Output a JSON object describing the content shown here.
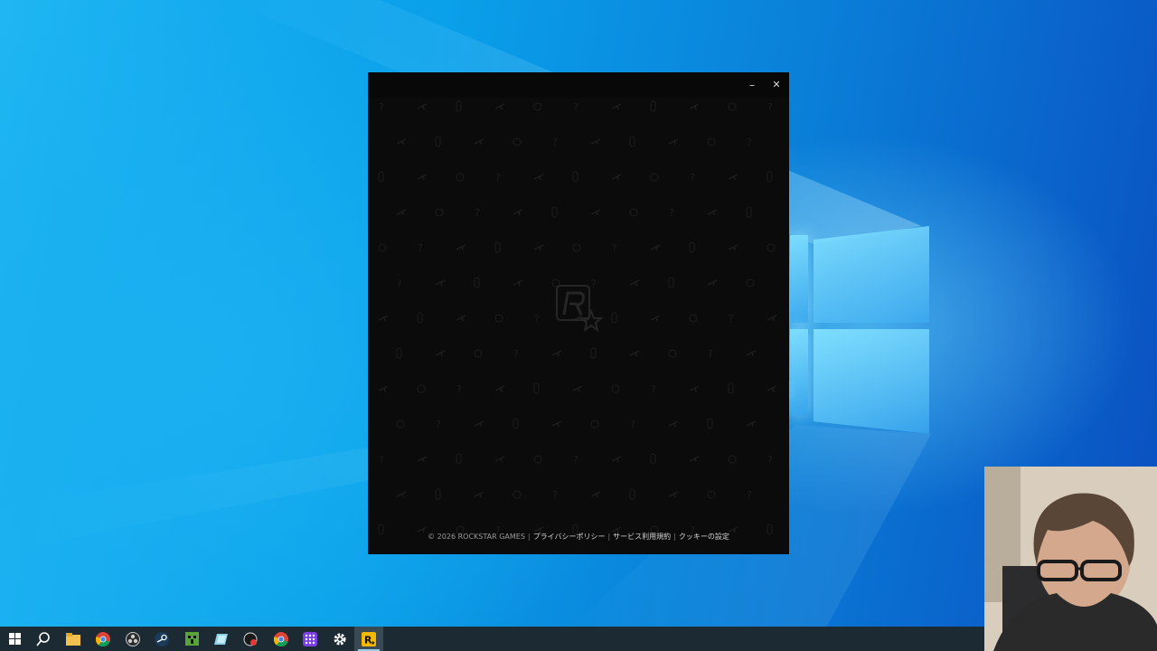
{
  "window": {
    "minimize_symbol": "–",
    "close_symbol": "✕"
  },
  "footer": {
    "copyright": "© 2026 ROCKSTAR GAMES",
    "separator": "|",
    "links": [
      "プライバシーポリシー",
      "サービス利用規約",
      "クッキーの設定"
    ]
  },
  "taskbar": {
    "items": [
      {
        "icon": "windows-start-icon",
        "active": false
      },
      {
        "icon": "search-icon",
        "active": false
      },
      {
        "icon": "file-explorer-icon",
        "active": false
      },
      {
        "icon": "chrome-icon",
        "active": false
      },
      {
        "icon": "obs-icon",
        "active": false
      },
      {
        "icon": "steam-icon",
        "active": false
      },
      {
        "icon": "minecraft-icon",
        "active": false
      },
      {
        "icon": "notes-app-icon",
        "active": false
      },
      {
        "icon": "record-app-icon",
        "active": false
      },
      {
        "icon": "chrome-icon",
        "active": false
      },
      {
        "icon": "grid-app-icon",
        "active": false
      },
      {
        "icon": "settings-gear-icon",
        "active": false
      },
      {
        "icon": "rockstar-launcher-icon",
        "active": true
      }
    ]
  },
  "colors": {
    "desktop_accent": "#0a7fd8",
    "window_bg": "#0b0b0b",
    "taskbar_bg": "#1b2a33",
    "rockstar_yellow": "#f5b800"
  }
}
